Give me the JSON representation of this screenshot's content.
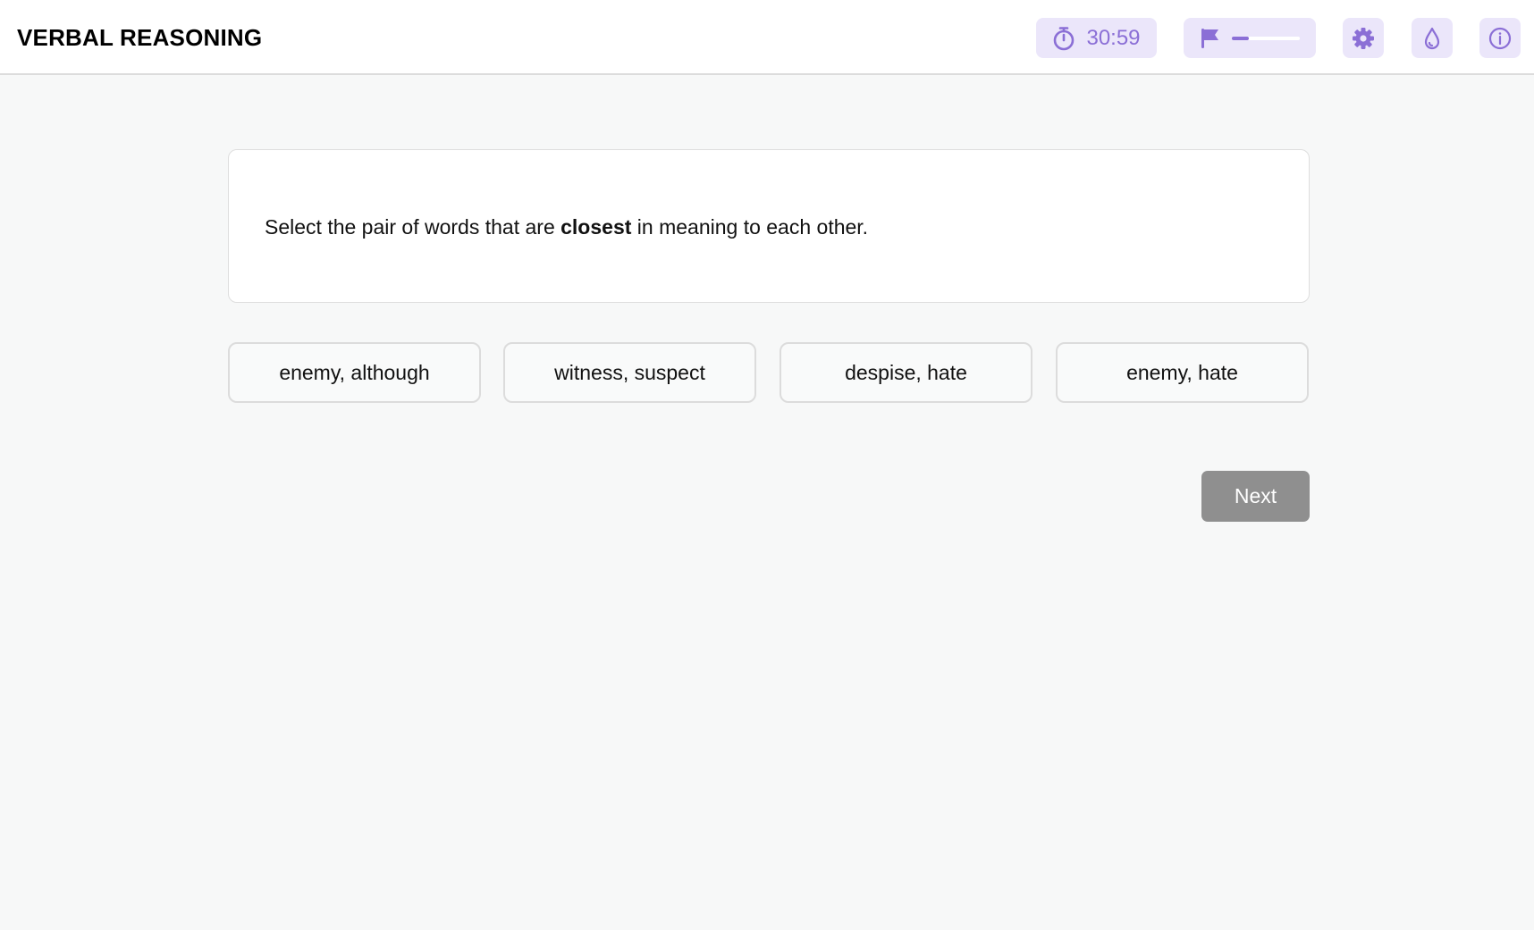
{
  "header": {
    "title": "VERBAL REASONING",
    "timer": {
      "value": "30:59",
      "icon": "stopwatch-icon"
    },
    "flag": {
      "icon": "flag-icon",
      "progress_fraction": 0.25
    },
    "settings_icon": "gear-icon",
    "contrast_icon": "droplet-icon",
    "info_icon": "info-icon"
  },
  "question": {
    "prefix": "Select the pair of words that are ",
    "emphasis": "closest",
    "suffix": " in meaning to each other."
  },
  "options": [
    {
      "label": "enemy, although"
    },
    {
      "label": "witness, suspect"
    },
    {
      "label": "despise, hate"
    },
    {
      "label": "enemy, hate"
    }
  ],
  "next_button": {
    "label": "Next"
  },
  "colors": {
    "accent": "#8b6fd6",
    "accent_bg": "#ebe6fa",
    "next_bg": "#8f8f8f",
    "page_bg": "#f7f8f8"
  }
}
